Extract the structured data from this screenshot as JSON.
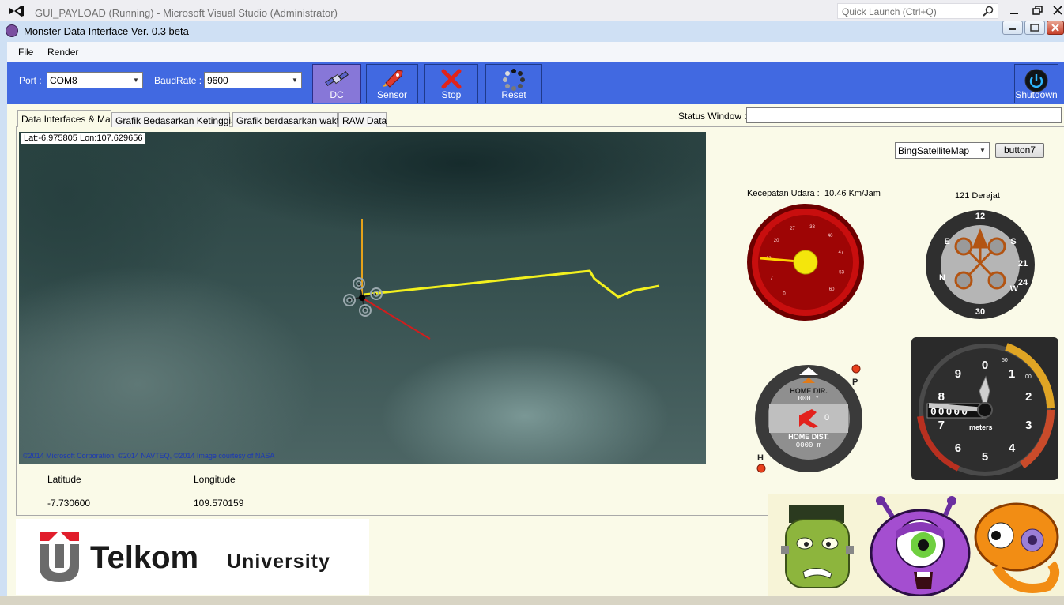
{
  "vs": {
    "title": "GUI_PAYLOAD (Running) - Microsoft Visual Studio (Administrator)",
    "quick_launch": "Quick Launch (Ctrl+Q)"
  },
  "app": {
    "title": "Monster Data Interface Ver. 0.3 beta"
  },
  "menu": {
    "file": "File",
    "render": "Render"
  },
  "toolbar": {
    "port_label": "Port :",
    "port_value": "COM8",
    "baud_label": "BaudRate :",
    "baud_value": "9600",
    "dc_label": "DC",
    "sensor_label": "Sensor",
    "stop_label": "Stop",
    "reset_label": "Reset",
    "shutdown_label": "Shutdown"
  },
  "tabs": [
    {
      "label": "Data Interfaces & Map"
    },
    {
      "label": "Grafik Bedasarkan Ketinggian"
    },
    {
      "label": "Grafik berdasarkan waktu"
    },
    {
      "label": "RAW Data"
    }
  ],
  "status": {
    "label": "Status Window :",
    "value": ""
  },
  "map": {
    "coord": "Lat:-6.975805 Lon:107.629656",
    "copyright": "©2014 Microsoft Corporation, ©2014 NAVTEQ, ©2014 Image courtesy of NASA",
    "provider": "BingSatelliteMap",
    "button": "button7",
    "track_color": "#f2f01e",
    "heading_color": "#e6a21a",
    "bearing_color": "#d41c1c"
  },
  "position": {
    "lat_label": "Latitude",
    "lat_value": "-7.730600",
    "lon_label": "Longitude",
    "lon_value": "109.570159"
  },
  "gauges": {
    "airspeed_caption": "Kecepatan Udara :",
    "airspeed_value": "10.46 Km/Jam",
    "airspeed_ticks": [
      "0",
      "7",
      "13",
      "20",
      "27",
      "33",
      "40",
      "47",
      "53",
      "60"
    ],
    "heading_caption": "121 Derajat",
    "home_dir_label": "HOME DIR.",
    "home_dir_value": "000 °",
    "home_dist_label": "HOME DIST.",
    "home_dist_value": "0000 m",
    "home_mid_value": "0",
    "p_label": "P",
    "h_label": "H",
    "altimeter_numbers": [
      "0",
      "1",
      "2",
      "3",
      "4",
      "5",
      "6",
      "7",
      "8",
      "9"
    ],
    "altimeter_unit": "meters",
    "altimeter_small": "50",
    "altimeter_small2": "00",
    "altimeter_counter": "00000"
  },
  "brand": {
    "word": "Telkom",
    "sub": "University"
  }
}
